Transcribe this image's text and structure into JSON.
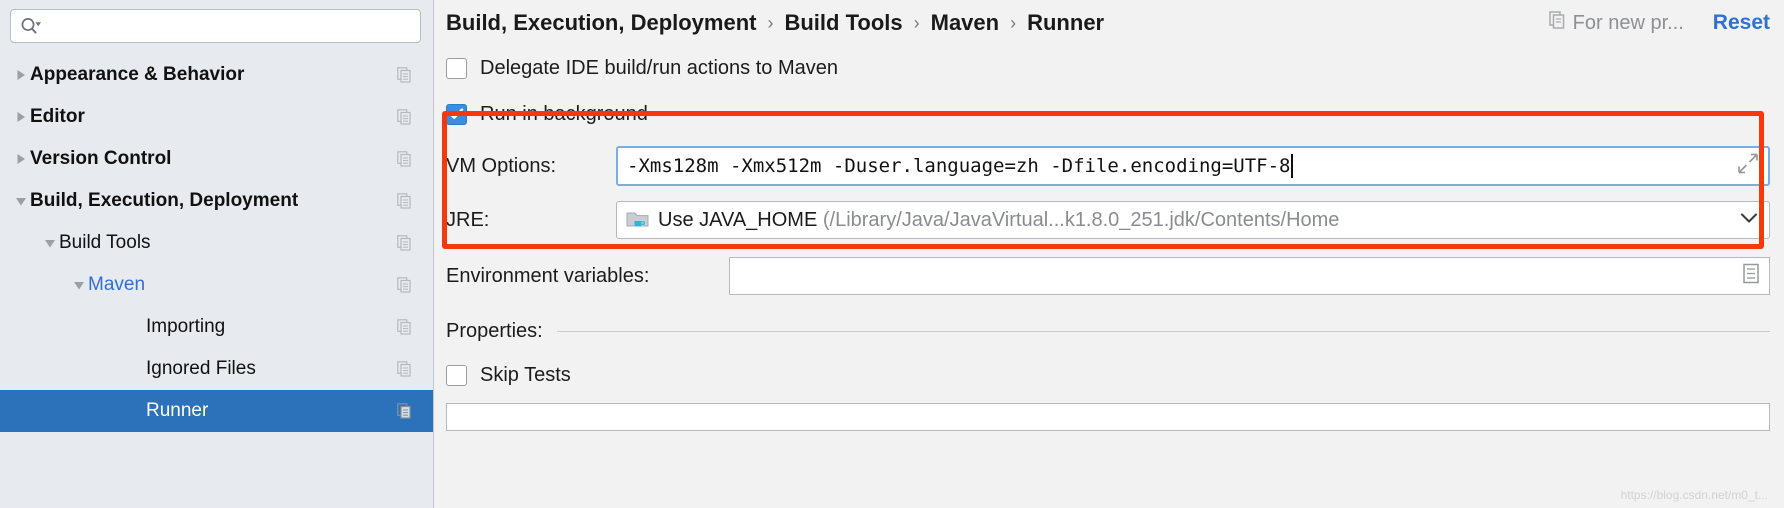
{
  "sidebar": {
    "search": {
      "value": "",
      "placeholder": "",
      "icon": "search-icon"
    },
    "items": [
      {
        "label": "Appearance & Behavior",
        "level": 0,
        "twisty": "collapsed",
        "bold": true,
        "selected": false,
        "copy": true
      },
      {
        "label": "Editor",
        "level": 0,
        "twisty": "collapsed",
        "bold": true,
        "selected": false,
        "copy": true
      },
      {
        "label": "Version Control",
        "level": 0,
        "twisty": "collapsed",
        "bold": true,
        "selected": false,
        "copy": true
      },
      {
        "label": "Build, Execution, Deployment",
        "level": 0,
        "twisty": "expanded",
        "bold": true,
        "selected": false,
        "copy": true
      },
      {
        "label": "Build Tools",
        "level": 1,
        "twisty": "expanded",
        "bold": false,
        "selected": false,
        "copy": true
      },
      {
        "label": "Maven",
        "level": 2,
        "twisty": "expanded",
        "bold": false,
        "selected": false,
        "copy": true,
        "accent": true
      },
      {
        "label": "Importing",
        "level": 3,
        "twisty": "none",
        "bold": false,
        "selected": false,
        "copy": true
      },
      {
        "label": "Ignored Files",
        "level": 3,
        "twisty": "none",
        "bold": false,
        "selected": false,
        "copy": true
      },
      {
        "label": "Runner",
        "level": 3,
        "twisty": "none",
        "bold": false,
        "selected": true,
        "copy": true
      }
    ]
  },
  "header": {
    "breadcrumb": [
      "Build, Execution, Deployment",
      "Build Tools",
      "Maven",
      "Runner"
    ],
    "separator": "›",
    "for_new_projects": "For new pr...",
    "for_new_icon": "copy-icon",
    "reset_label": "Reset"
  },
  "form": {
    "delegate": {
      "label": "Delegate IDE build/run actions to Maven",
      "checked": false
    },
    "run_in_background": {
      "label": "Run in background",
      "checked": true
    },
    "vm_options": {
      "label": "VM Options:",
      "value": "-Xms128m -Xmx512m -Duser.language=zh -Dfile.encoding=UTF-8",
      "expand_icon": "expand-icon"
    },
    "jre": {
      "label": "JRE:",
      "value": "Use JAVA_HOME",
      "path": "(/Library/Java/JavaVirtual...k1.8.0_251.jdk/Contents/Home",
      "icon": "java-folder-icon",
      "arrow": "chevron-down-icon"
    },
    "environment_variables": {
      "label": "Environment variables:",
      "value": "",
      "browse_icon": "list-edit-icon"
    },
    "properties": {
      "label": "Properties:"
    },
    "skip_tests": {
      "label": "Skip Tests",
      "checked": false
    }
  },
  "annotation": {
    "color": "#f7380c"
  },
  "watermark": "https://blog.csdn.net/m0_t..."
}
